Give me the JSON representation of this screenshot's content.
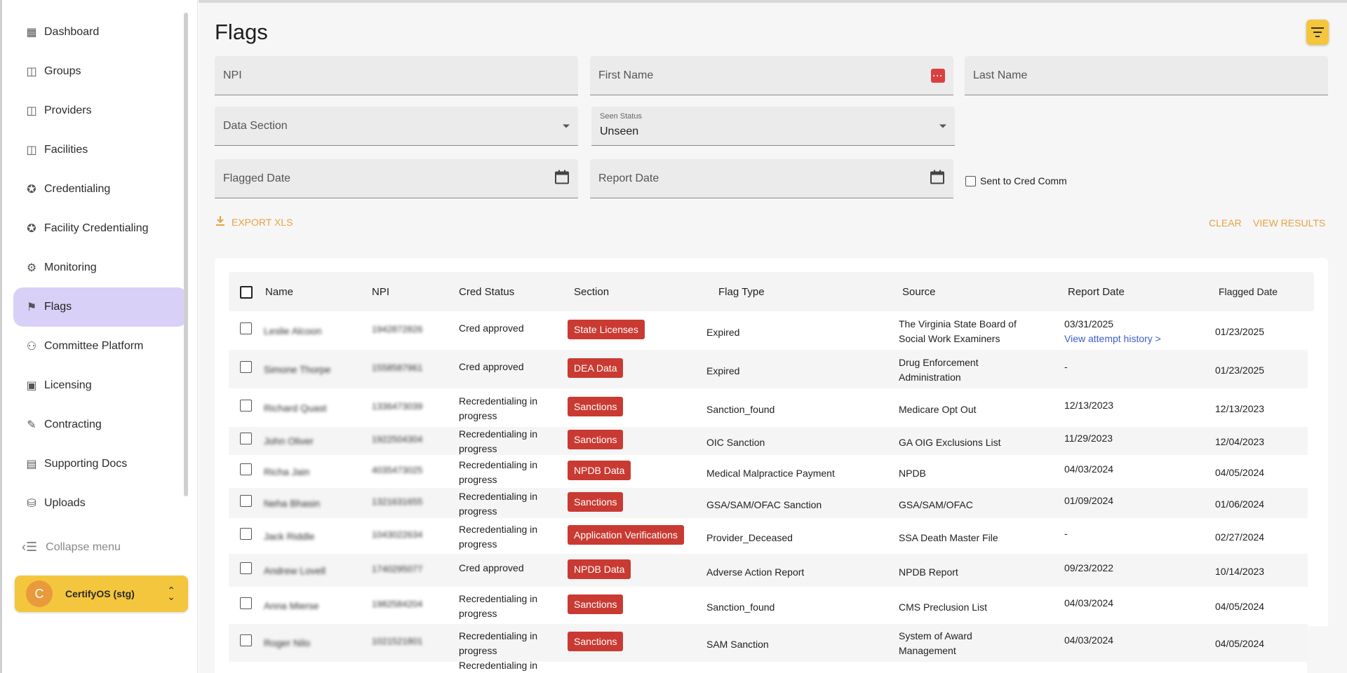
{
  "sidebar": {
    "items": [
      {
        "label": "Dashboard",
        "icon": "dashboard-icon"
      },
      {
        "label": "Groups",
        "icon": "groups-icon"
      },
      {
        "label": "Providers",
        "icon": "providers-icon"
      },
      {
        "label": "Facilities",
        "icon": "facilities-icon"
      },
      {
        "label": "Credentialing",
        "icon": "credentialing-icon"
      },
      {
        "label": "Facility Credentialing",
        "icon": "facility-credentialing-icon"
      },
      {
        "label": "Monitoring",
        "icon": "monitoring-icon"
      },
      {
        "label": "Flags",
        "icon": "flag-icon",
        "active": true
      },
      {
        "label": "Committee Platform",
        "icon": "committee-icon"
      },
      {
        "label": "Licensing",
        "icon": "licensing-icon"
      },
      {
        "label": "Contracting",
        "icon": "contracting-icon"
      },
      {
        "label": "Supporting Docs",
        "icon": "document-icon"
      },
      {
        "label": "Uploads",
        "icon": "uploads-icon"
      }
    ],
    "collapse_label": "Collapse menu",
    "org": {
      "initial": "C",
      "name": "CertifyOS (stg)"
    }
  },
  "page": {
    "title": "Flags"
  },
  "filters": {
    "npi_placeholder": "NPI",
    "first_name_placeholder": "First Name",
    "last_name_placeholder": "Last Name",
    "data_section_placeholder": "Data Section",
    "seen_status_label": "Seen Status",
    "seen_status_value": "Unseen",
    "flagged_date_placeholder": "Flagged Date",
    "report_date_placeholder": "Report Date",
    "sent_to_cred_comm_label": "Sent to Cred Comm",
    "sent_to_cred_comm_checked": false
  },
  "actions": {
    "export_label": "EXPORT XLS",
    "clear_label": "CLEAR",
    "view_results_label": "VIEW RESULTS"
  },
  "colors": {
    "accent": "#f4c63d",
    "action_text": "#e6a245",
    "active_nav": "#d9d0f7",
    "tag": "#c93a32",
    "link": "#3b5fc8"
  },
  "table": {
    "headers": {
      "name": "Name",
      "npi": "NPI",
      "cred_status": "Cred Status",
      "section": "Section",
      "flag_type": "Flag Type",
      "source": "Source",
      "report_date": "Report Date",
      "flagged_date": "Flagged Date"
    },
    "attempt_history_link": "View attempt history >",
    "rows": [
      {
        "name": "Leslie Alcoon",
        "npi": "1942872826",
        "cred_status": "Cred approved",
        "section": "State Licenses",
        "flag_type": "Expired",
        "source": "The Virginia State Board of Social Work Examiners",
        "report_date": "03/31/2025",
        "flagged_date": "01/23/2025"
      },
      {
        "name": "Simone Thorpe",
        "npi": "1558587961",
        "cred_status": "Cred approved",
        "section": "DEA Data",
        "flag_type": "Expired",
        "source": "Drug Enforcement Administration",
        "report_date": "-",
        "flagged_date": "01/23/2025"
      },
      {
        "name": "Richard Quast",
        "npi": "1336473039",
        "cred_status": "Recredentialing in progress",
        "section": "Sanctions",
        "flag_type": "Sanction_found",
        "source": "Medicare Opt Out",
        "report_date": "12/13/2023",
        "flagged_date": "12/13/2023"
      },
      {
        "name": "John Oliver",
        "npi": "1922504304",
        "cred_status": "Recredentialing in progress",
        "section": "Sanctions",
        "flag_type": "OIC Sanction",
        "source": "GA OIG Exclusions List",
        "report_date": "11/29/2023",
        "flagged_date": "12/04/2023"
      },
      {
        "name": "Richa Jain",
        "npi": "4035473025",
        "cred_status": "Recredentialing in progress",
        "section": "NPDB Data",
        "flag_type": "Medical Malpractice Payment",
        "source": "NPDB",
        "report_date": "04/03/2024",
        "flagged_date": "04/05/2024"
      },
      {
        "name": "Neha Bhasin",
        "npi": "1321631655",
        "cred_status": "Recredentialing in progress",
        "section": "Sanctions",
        "flag_type": "GSA/SAM/OFAC Sanction",
        "source": "GSA/SAM/OFAC",
        "report_date": "01/09/2024",
        "flagged_date": "01/06/2024"
      },
      {
        "name": "Jack Riddle",
        "npi": "1043022634",
        "cred_status": "Recredentialing in progress",
        "section": "Application Verifications",
        "flag_type": "Provider_Deceased",
        "source": "SSA Death Master File",
        "report_date": "-",
        "flagged_date": "02/27/2024"
      },
      {
        "name": "Andrew Lovell",
        "npi": "1740295077",
        "cred_status": "Cred approved",
        "section": "NPDB Data",
        "flag_type": "Adverse Action Report",
        "source": "NPDB Report",
        "report_date": "09/23/2022",
        "flagged_date": "10/14/2023"
      },
      {
        "name": "Anna Mierse",
        "npi": "1982584204",
        "cred_status": "Recredentialing in progress",
        "section": "Sanctions",
        "flag_type": "Sanction_found",
        "source": "CMS  Preclusion List",
        "report_date": "04/03/2024",
        "flagged_date": "04/05/2024"
      },
      {
        "name": "Roger Nilo",
        "npi": "1021521801",
        "cred_status": "Recredentialing in progress",
        "section": "Sanctions",
        "flag_type": "SAM Sanction",
        "source": "System of Award Management",
        "report_date": "04/03/2024",
        "flagged_date": "04/05/2024"
      },
      {
        "name": "",
        "npi": "",
        "cred_status": "Recredentialing in",
        "section": "",
        "flag_type": "",
        "source": "",
        "report_date": "",
        "flagged_date": ""
      }
    ]
  }
}
